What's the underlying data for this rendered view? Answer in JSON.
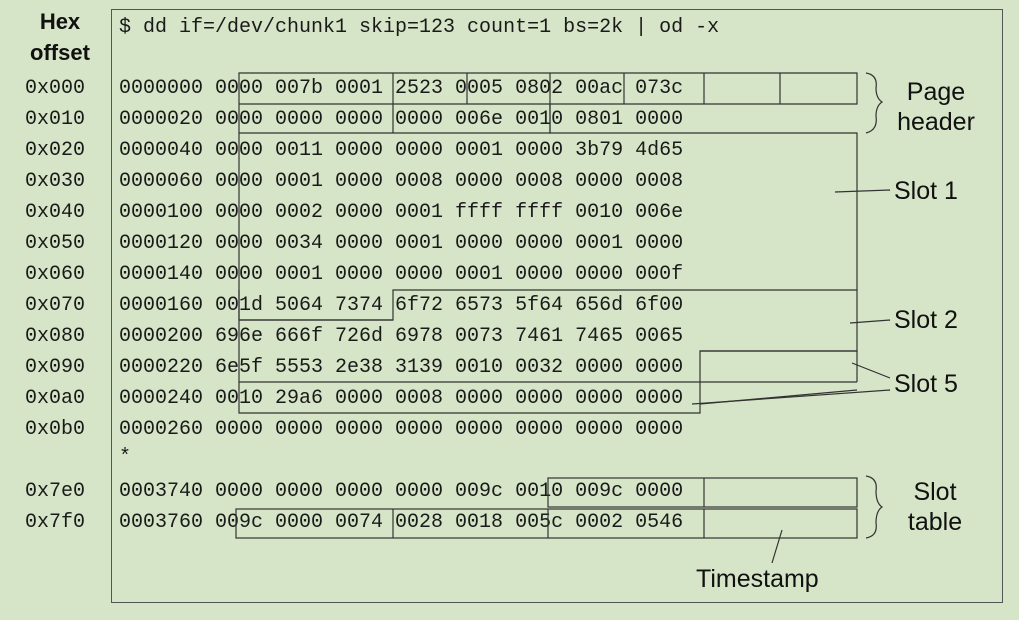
{
  "header": {
    "hex": "Hex",
    "offset": "offset",
    "command": "$ dd if=/dev/chunk1 skip=123 count=1 bs=2k | od -x"
  },
  "rows": [
    {
      "hex": "0x000",
      "line": "0000000 0000 007b 0001 2523 0005 0802 00ac 073c"
    },
    {
      "hex": "0x010",
      "line": "0000020 0000 0000 0000 0000 006e 0010 0801 0000"
    },
    {
      "hex": "0x020",
      "line": "0000040 0000 0011 0000 0000 0001 0000 3b79 4d65"
    },
    {
      "hex": "0x030",
      "line": "0000060 0000 0001 0000 0008 0000 0008 0000 0008"
    },
    {
      "hex": "0x040",
      "line": "0000100 0000 0002 0000 0001 ffff ffff 0010 006e"
    },
    {
      "hex": "0x050",
      "line": "0000120 0000 0034 0000 0001 0000 0000 0001 0000"
    },
    {
      "hex": "0x060",
      "line": "0000140 0000 0001 0000 0000 0001 0000 0000 000f"
    },
    {
      "hex": "0x070",
      "line": "0000160 001d 5064 7374 6f72 6573 5f64 656d 6f00"
    },
    {
      "hex": "0x080",
      "line": "0000200 696e 666f 726d 6978 0073 7461 7465 0065"
    },
    {
      "hex": "0x090",
      "line": "0000220 6e5f 5553 2e38 3139 0010 0032 0000 0000"
    },
    {
      "hex": "0x0a0",
      "line": "0000240 0010 29a6 0000 0008 0000 0000 0000 0000"
    },
    {
      "hex": "0x0b0",
      "line": "0000260 0000 0000 0000 0000 0000 0000 0000 0000"
    },
    {
      "hex": "",
      "line": "*"
    },
    {
      "hex": "0x7e0",
      "line": "0003740 0000 0000 0000 0000 009c 0010 009c 0000"
    },
    {
      "hex": "0x7f0",
      "line": "0003760 009c 0000 0074 0028 0018 005c 0002 0546"
    }
  ],
  "labels": {
    "page_header": [
      "Page",
      "header"
    ],
    "slot1": "Slot 1",
    "slot2": "Slot 2",
    "slot5": "Slot 5",
    "slot_table": [
      "Slot",
      "table"
    ],
    "timestamp": "Timestamp"
  }
}
